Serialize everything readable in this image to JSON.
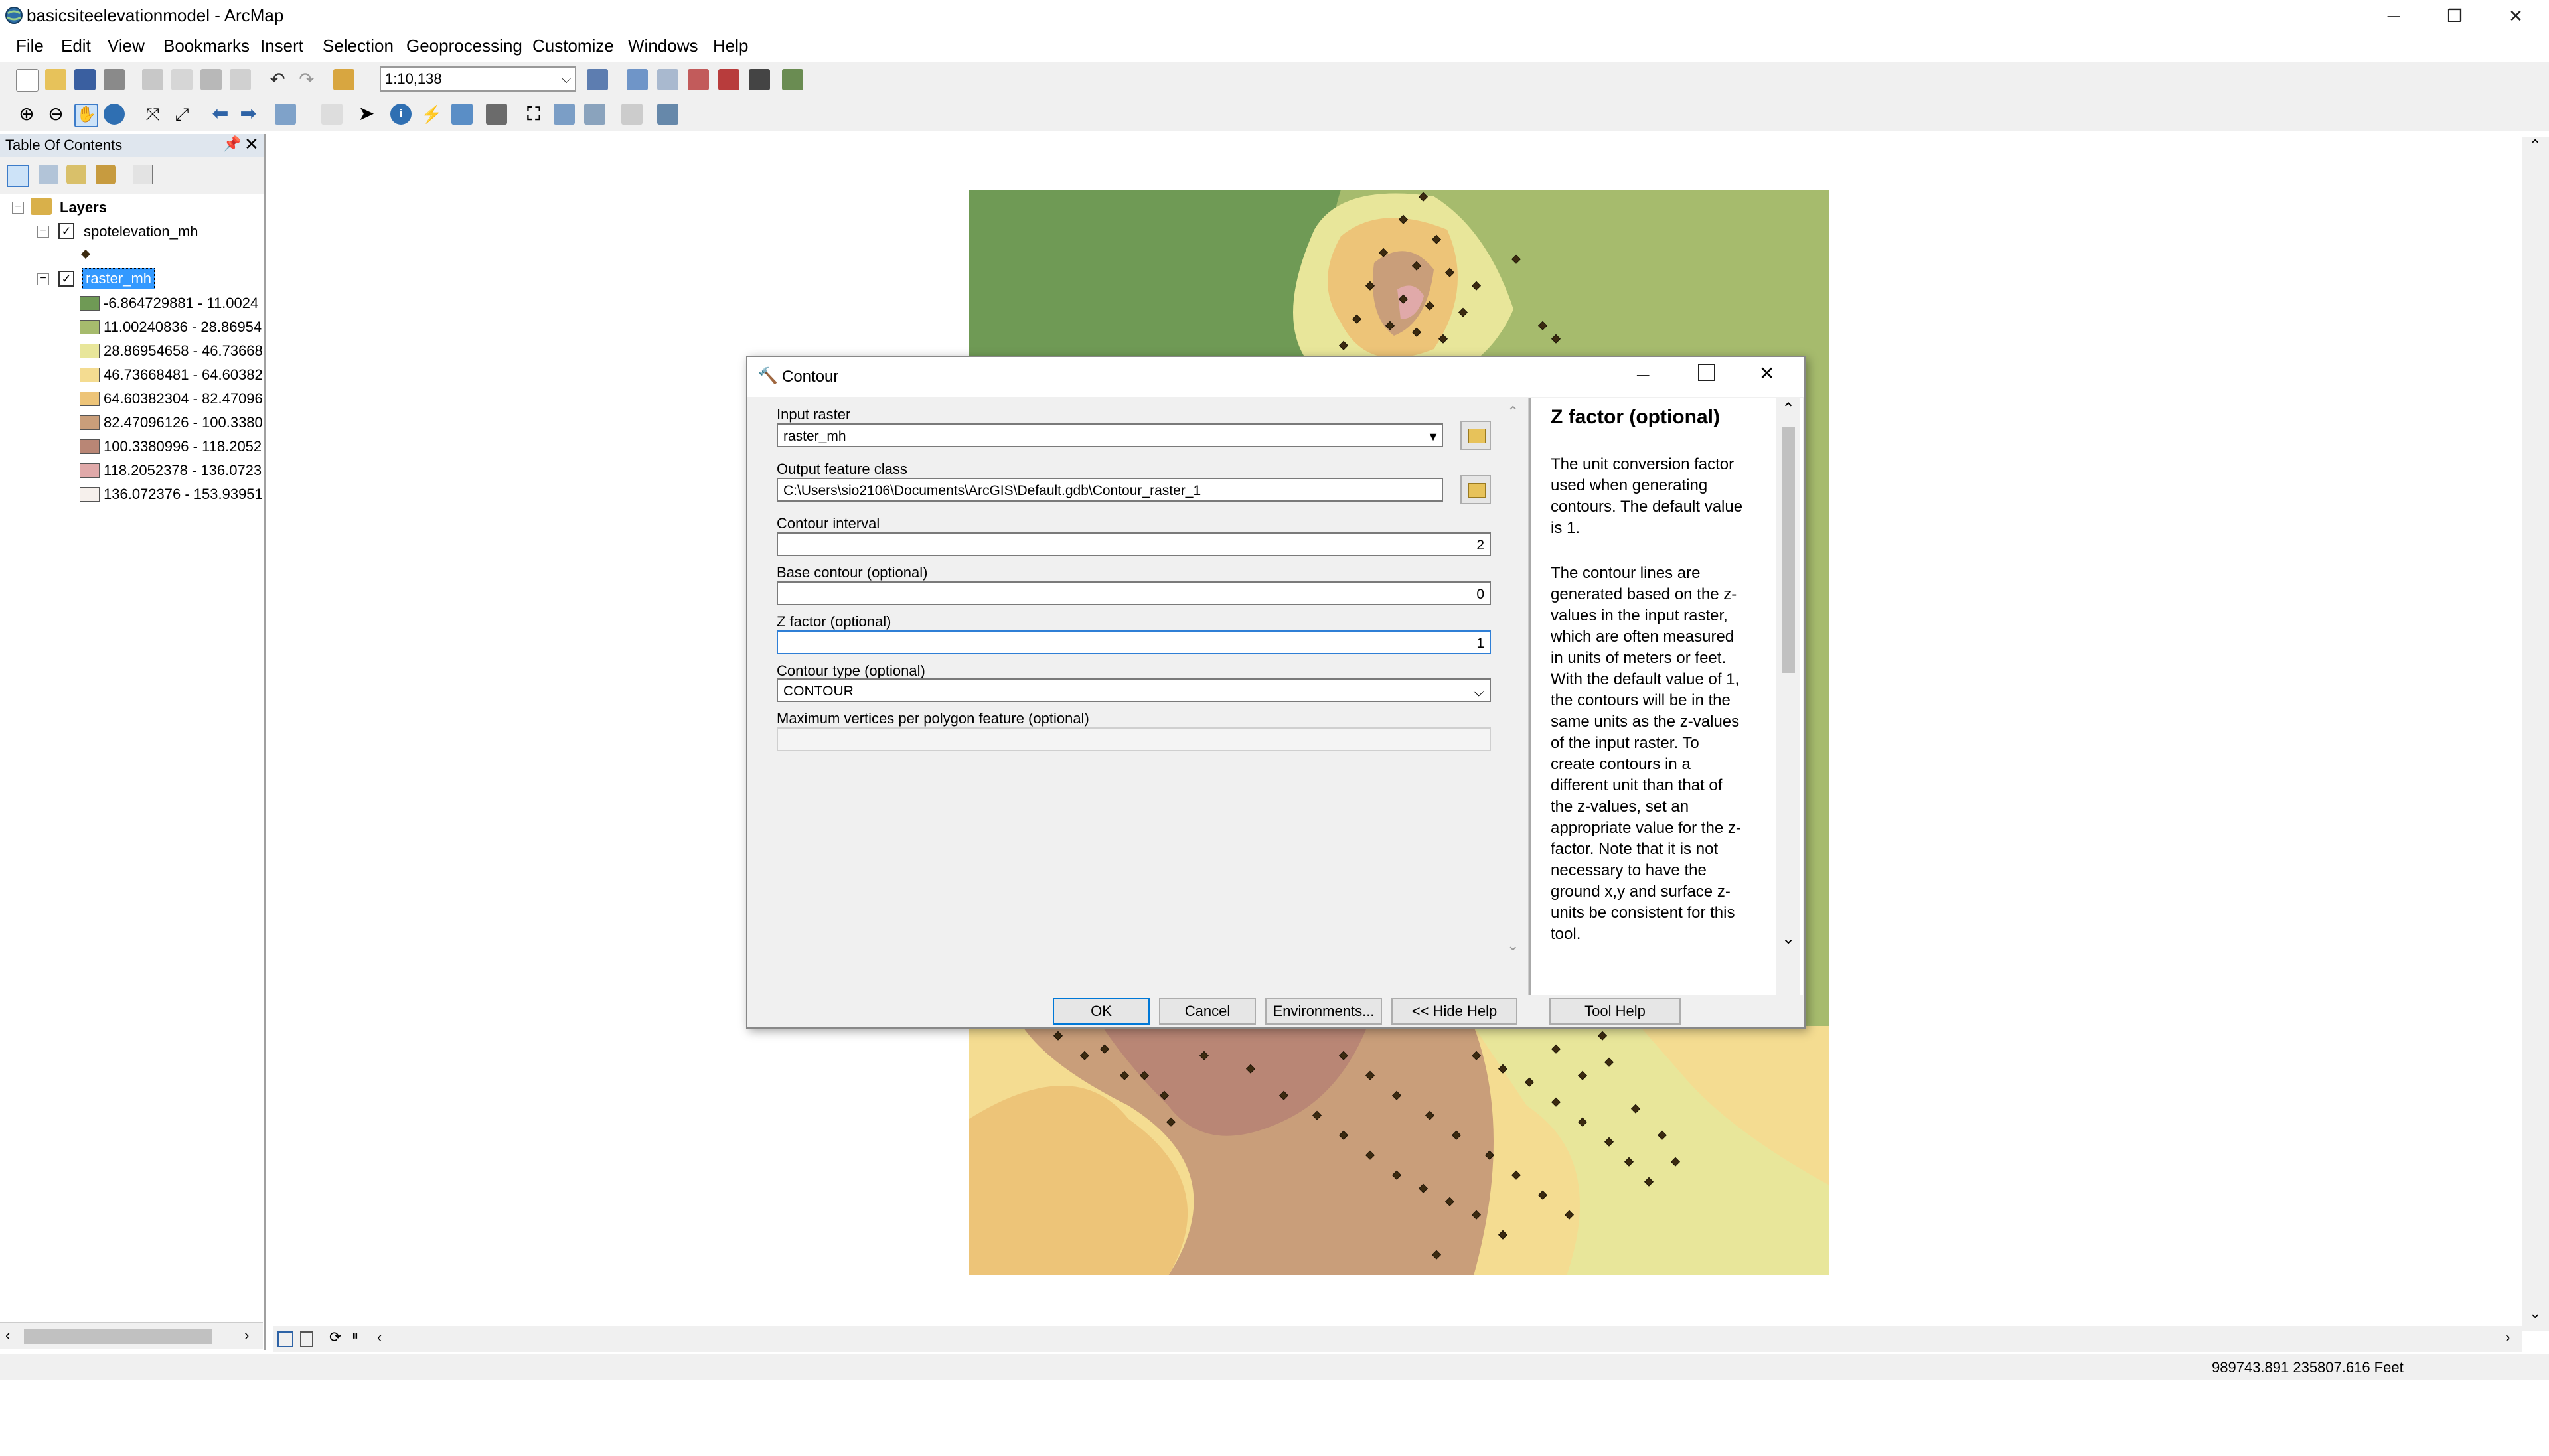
{
  "window": {
    "title": "basicsiteelevationmodel - ArcMap"
  },
  "menu": [
    "File",
    "Edit",
    "View",
    "Bookmarks",
    "Insert",
    "Selection",
    "Geoprocessing",
    "Customize",
    "Windows",
    "Help"
  ],
  "toolbar": {
    "scale": "1:10,138"
  },
  "toc": {
    "title": "Table Of Contents",
    "root": "Layers",
    "layers": [
      {
        "name": "spotelevation_mh"
      },
      {
        "name": "raster_mh",
        "classes": [
          {
            "label": "-6.864729881 - 11.0024",
            "color": "#6f9a55"
          },
          {
            "label": "11.00240836 - 28.86954",
            "color": "#a6bb6d"
          },
          {
            "label": "28.86954658 - 46.73668",
            "color": "#e8e69a"
          },
          {
            "label": "46.73668481 - 64.60382",
            "color": "#f4dc91"
          },
          {
            "label": "64.60382304 - 82.47096",
            "color": "#edc478"
          },
          {
            "label": "82.47096126 - 100.3380",
            "color": "#c99e7a"
          },
          {
            "label": "100.3380996 - 118.2052",
            "color": "#b98675"
          },
          {
            "label": "118.2052378 - 136.0723",
            "color": "#e0a9a9"
          },
          {
            "label": "136.072376 - 153.93951",
            "color": "#f6f0ec"
          }
        ]
      }
    ]
  },
  "dialog": {
    "title": "Contour",
    "input_raster_label": "Input raster",
    "input_raster_value": "raster_mh",
    "output_label": "Output feature class",
    "output_value": "C:\\Users\\sio2106\\Documents\\ArcGIS\\Default.gdb\\Contour_raster_1",
    "interval_label": "Contour interval",
    "interval_value": "2",
    "base_label": "Base contour (optional)",
    "base_value": "0",
    "z_label": "Z factor (optional)",
    "z_value": "1",
    "type_label": "Contour type (optional)",
    "type_value": "CONTOUR",
    "maxvert_label": "Maximum vertices per polygon feature (optional)",
    "buttons": {
      "ok": "OK",
      "cancel": "Cancel",
      "env": "Environments...",
      "hide_help": "<< Hide Help",
      "tool_help": "Tool Help"
    },
    "help": {
      "heading": "Z factor (optional)",
      "lines": [
        "The unit conversion factor",
        "used when generating",
        "contours. The default value",
        "is 1.",
        "",
        "The contour lines are",
        "generated based on the z-",
        "values in the input raster,",
        "which are often measured",
        "in units of meters or feet.",
        "With the default value of 1,",
        "the contours will be in the",
        "same units as the z-values",
        "of the input raster. To",
        "create contours in a",
        "different unit than that of",
        "the z-values, set an",
        "appropriate value for the z-",
        "factor. Note that it is not",
        "necessary to have the",
        "ground x,y and surface z-",
        "units be consistent for this",
        "tool."
      ]
    }
  },
  "status": {
    "coords": "989743.891  235807.616 Feet"
  }
}
